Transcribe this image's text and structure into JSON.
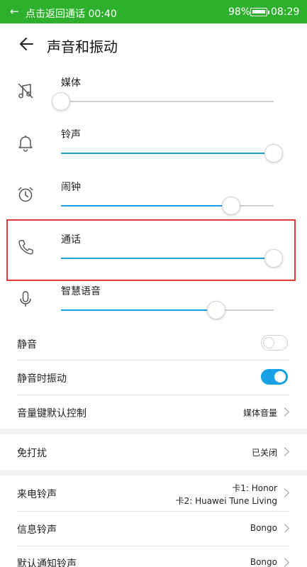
{
  "status_bar": {
    "back_symbol": "←",
    "call_text": "点击返回通话 00:40",
    "battery_percent": "98%",
    "battery_level": 0.98,
    "time": "08:29"
  },
  "header": {
    "title": "声音和振动",
    "back_icon": "arrow-left-icon"
  },
  "volume": [
    {
      "label": "媒体",
      "icon": "music-off-icon",
      "level": 0.0
    },
    {
      "label": "铃声",
      "icon": "bell-icon",
      "level": 1.0
    },
    {
      "label": "闹钟",
      "icon": "alarm-clock-icon",
      "level": 0.8
    },
    {
      "label": "通话",
      "icon": "phone-icon",
      "level": 1.0
    },
    {
      "label": "智慧语音",
      "icon": "microphone-icon",
      "level": 0.73
    }
  ],
  "settings": {
    "mute": {
      "label": "静音",
      "on": false
    },
    "vibrate_when_muted": {
      "label": "静音时振动",
      "on": true
    },
    "volume_key_default": {
      "label": "音量键默认控制",
      "value": "媒体音量"
    },
    "do_not_disturb": {
      "label": "免打扰",
      "value": "已关闭"
    },
    "ringtone": {
      "label": "来电铃声",
      "value_line1": "卡1: Honor",
      "value_line2": "卡2: Huawei Tune Living"
    },
    "message_tone": {
      "label": "信息铃声",
      "value": "Bongo"
    },
    "notification_tone": {
      "label": "默认通知铃声",
      "value": "Bongo"
    }
  },
  "colors": {
    "status_bar": "#2db12c",
    "accent": "#19a1e6",
    "highlight_box": "#e23b3b"
  }
}
